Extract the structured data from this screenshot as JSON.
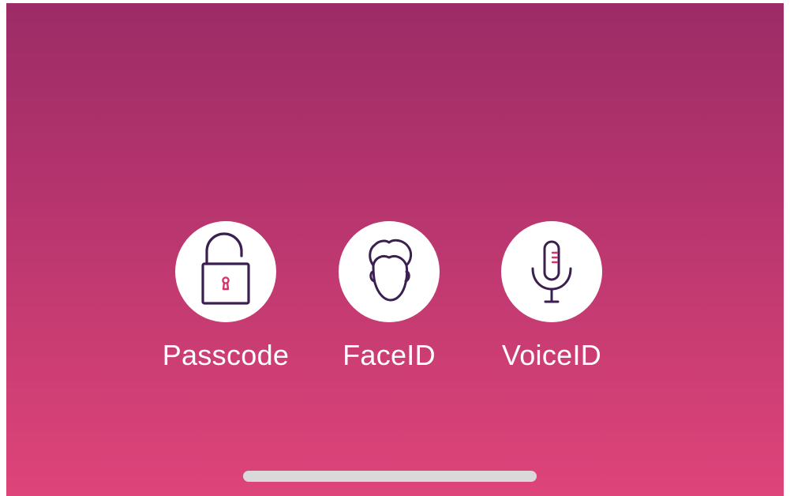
{
  "auth_options": [
    {
      "label": "Passcode",
      "icon": "open-padlock-icon"
    },
    {
      "label": "FaceID",
      "icon": "face-icon"
    },
    {
      "label": "VoiceID",
      "icon": "microphone-icon"
    }
  ],
  "colors": {
    "background_top": "#9c2c66",
    "background_bottom": "#de4479",
    "icon_stroke": "#3b1f4e",
    "icon_accent": "#d6336c",
    "circle_fill": "#ffffff",
    "home_indicator": "#d9d9d9"
  }
}
